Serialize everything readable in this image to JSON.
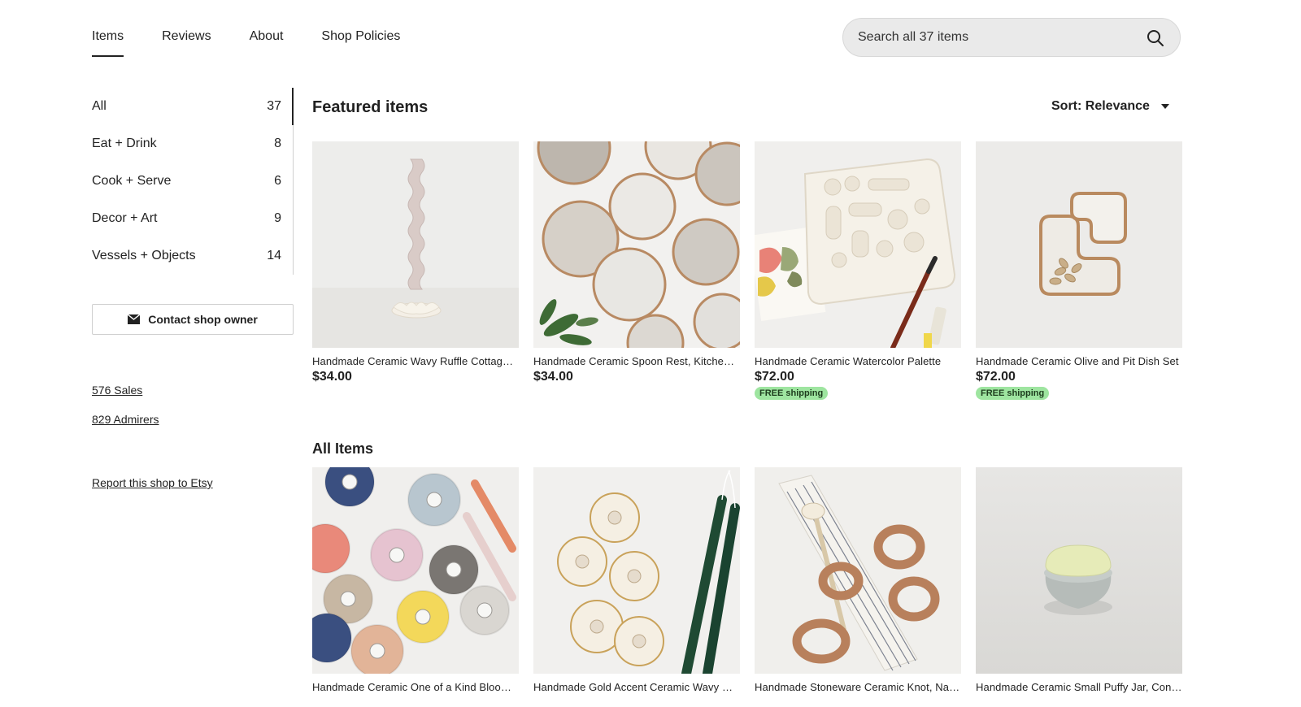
{
  "nav": {
    "tabs": [
      {
        "label": "Items"
      },
      {
        "label": "Reviews"
      },
      {
        "label": "About"
      },
      {
        "label": "Shop Policies"
      }
    ],
    "active_tab": "Items"
  },
  "search": {
    "placeholder": "Search all 37 items",
    "icon": "search-icon"
  },
  "sidebar": {
    "categories": [
      {
        "label": "All",
        "count": "37"
      },
      {
        "label": "Eat + Drink",
        "count": "8"
      },
      {
        "label": "Cook + Serve",
        "count": "6"
      },
      {
        "label": "Decor + Art",
        "count": "9"
      },
      {
        "label": "Vessels + Objects",
        "count": "14"
      }
    ],
    "contact_label": "Contact shop owner",
    "contact_icon": "envelope-icon",
    "sales": "576 Sales",
    "admirers": "829 Admirers",
    "report": "Report this shop to Etsy"
  },
  "featured": {
    "title": "Featured items",
    "sort_label": "Sort: Relevance",
    "items": [
      {
        "title": "Handmade Ceramic Wavy Ruffle Cottage Candle Holder",
        "price": "$34.00",
        "shipping": ""
      },
      {
        "title": "Handmade Ceramic Spoon Rest, Kitchen Decor",
        "price": "$34.00",
        "shipping": ""
      },
      {
        "title": "Handmade Ceramic Watercolor Palette",
        "price": "$72.00",
        "shipping": "FREE shipping"
      },
      {
        "title": "Handmade Ceramic Olive and Pit Dish Set",
        "price": "$72.00",
        "shipping": "FREE shipping"
      }
    ]
  },
  "all_items": {
    "title": "All Items",
    "items": [
      {
        "title": "Handmade Ceramic One of a Kind Bloom Candle Holder"
      },
      {
        "title": "Handmade Gold Accent Ceramic Wavy Candle Holder"
      },
      {
        "title": "Handmade Stoneware Ceramic Knot, Napkin Ring"
      },
      {
        "title": "Handmade Ceramic Small Puffy Jar, Container"
      }
    ]
  },
  "colors": {
    "free_shipping_badge": "#9ee5a0",
    "search_bg": "#eaeaea",
    "text": "#222222"
  }
}
